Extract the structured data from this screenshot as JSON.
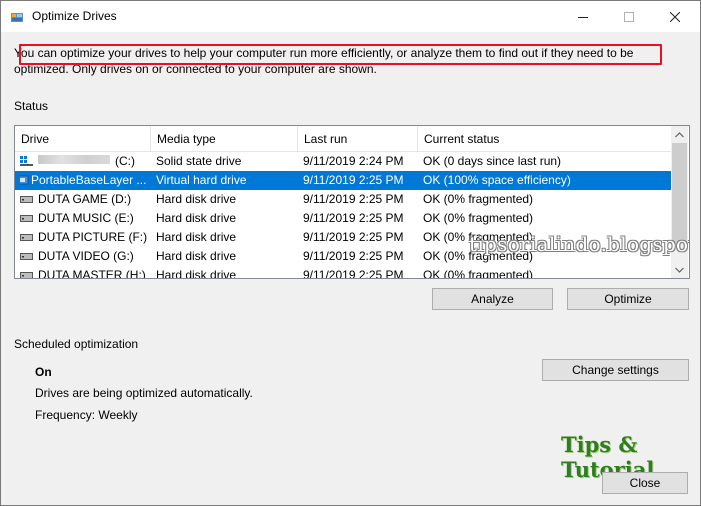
{
  "window": {
    "title": "Optimize Drives",
    "controls": {
      "minimize": "–",
      "maximize": "☐",
      "close": "✕"
    }
  },
  "description": "You can optimize your drives to help your computer run more efficiently, or analyze them to find out if they need to be optimized. Only drives on or connected to your computer are shown.",
  "status": {
    "label": "Status",
    "columns": [
      "Drive",
      "Media type",
      "Last run",
      "Current status"
    ],
    "drives": [
      {
        "name": "(C:)",
        "media": "Solid state drive",
        "last_run": "9/11/2019 2:24 PM",
        "status": "OK (0 days since last run)",
        "icon": "windows-drive-icon",
        "blurred": true
      },
      {
        "name": "PortableBaseLayer ...",
        "media": "Virtual hard drive",
        "last_run": "9/11/2019 2:25 PM",
        "status": "OK (100% space efficiency)",
        "icon": "virtual-drive-icon",
        "selected": true
      },
      {
        "name": "DUTA GAME (D:)",
        "media": "Hard disk drive",
        "last_run": "9/11/2019 2:25 PM",
        "status": "OK (0% fragmented)",
        "icon": "hard-drive-icon"
      },
      {
        "name": "DUTA MUSIC (E:)",
        "media": "Hard disk drive",
        "last_run": "9/11/2019 2:25 PM",
        "status": "OK (0% fragmented)",
        "icon": "hard-drive-icon"
      },
      {
        "name": "DUTA PICTURE (F:)",
        "media": "Hard disk drive",
        "last_run": "9/11/2019 2:25 PM",
        "status": "OK (0% fragmented)",
        "icon": "hard-drive-icon"
      },
      {
        "name": "DUTA VIDEO (G:)",
        "media": "Hard disk drive",
        "last_run": "9/11/2019 2:25 PM",
        "status": "OK (0% fragmented)",
        "icon": "hard-drive-icon"
      },
      {
        "name": "DUTA MASTER (H:)",
        "media": "Hard disk drive",
        "last_run": "9/11/2019 2:25 PM",
        "status": "OK (0% fragmented)",
        "icon": "hard-drive-icon"
      }
    ],
    "analyze_label": "Analyze",
    "optimize_label": "Optimize"
  },
  "scheduled": {
    "label": "Scheduled optimization",
    "state": "On",
    "message": "Drives are being optimized automatically.",
    "frequency": "Frequency: Weekly",
    "change_label": "Change settings"
  },
  "close_label": "Close",
  "overlays": {
    "watermark": "tipsorialindo.blogspot.com",
    "brand": "Tips & Tutorial"
  },
  "colors": {
    "selection": "#0078d7",
    "highlight_outline": "#e81123",
    "brand_green": "#2e7d1f"
  }
}
